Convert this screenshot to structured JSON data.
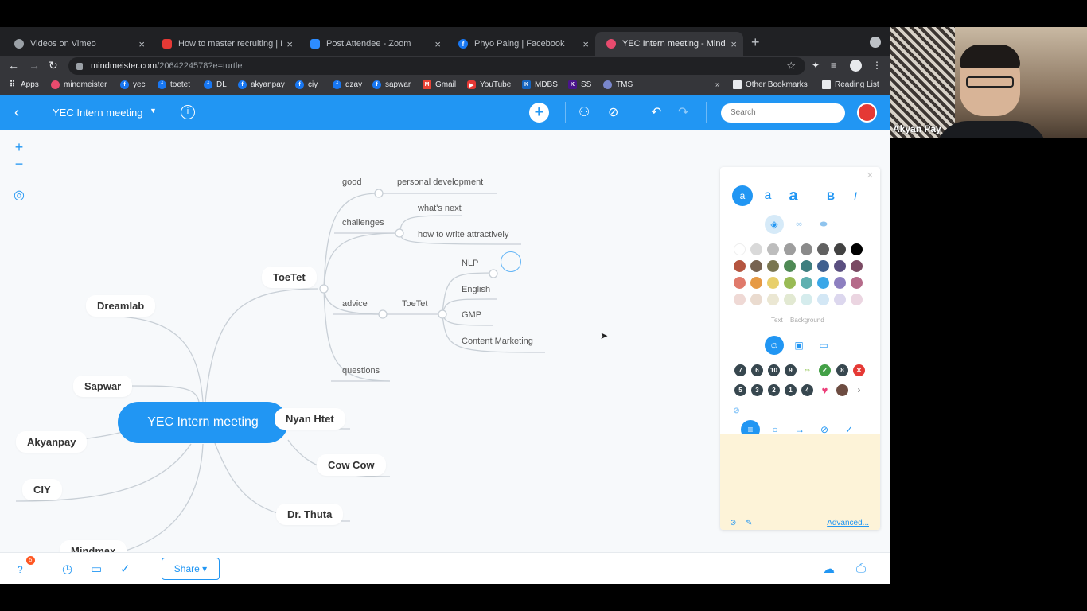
{
  "browser": {
    "tabs": [
      {
        "title": "Videos on Vimeo",
        "icon": "vimeo-icon"
      },
      {
        "title": "How to master recruiting | Mac",
        "icon": "youtube-icon"
      },
      {
        "title": "Post Attendee - Zoom",
        "icon": "zoom-icon"
      },
      {
        "title": "Phyo Paing | Facebook",
        "icon": "facebook-icon"
      },
      {
        "title": "YEC Intern meeting - MindMei",
        "icon": "mindmeister-icon"
      }
    ],
    "url_host": "mindmeister.com",
    "url_path": "/2064224578?e=turtle",
    "bookmarks": [
      "Apps",
      "mindmeister",
      "yec",
      "toetet",
      "DL",
      "akyanpay",
      "ciy",
      "dzay",
      "sapwar",
      "Gmail",
      "YouTube",
      "MDBS",
      "SS",
      "TMS"
    ],
    "bookmarks_more": "»",
    "other_bookmarks": "Other Bookmarks",
    "reading_list": "Reading List"
  },
  "app": {
    "map_title": "YEC Intern meeting",
    "search_placeholder": "Search",
    "accent": "#2196f3"
  },
  "map": {
    "root": "YEC Intern meeting",
    "left_nodes": [
      "Dreamlab",
      "Sapwar",
      "Akyanpay",
      "CIY",
      "Mindmax"
    ],
    "right_nodes": [
      "ToeTet",
      "Nyan Htet",
      "Cow Cow",
      "Dr. Thuta"
    ],
    "toetet_children": {
      "good": "good",
      "good_child": "personal development",
      "challenges": "challenges",
      "challenges_children": [
        "what's next",
        "how to write attractively"
      ],
      "advice": "advice",
      "advice_child": "ToeTet",
      "advice_grandchildren": [
        "NLP",
        "English",
        "GMP",
        "Content Marketing"
      ],
      "questions": "questions"
    }
  },
  "panel": {
    "font_sizes": [
      "a",
      "a",
      "a"
    ],
    "bold": "B",
    "italic": "I",
    "color_labels": [
      "Text",
      "Background"
    ],
    "icon_numbers_row1": [
      "7",
      "6",
      "10",
      "9"
    ],
    "icon_numbers_row2": [
      "5",
      "3",
      "2",
      "1",
      "4"
    ],
    "icon_8": "8",
    "advanced_link": "Advanced...",
    "swatch_rows": [
      [
        "#ffffff",
        "#d9d9d9",
        "#bdbdbd",
        "#9e9e9e",
        "#8a8a8a",
        "#616161",
        "#424242",
        "#000000"
      ],
      [
        "#b5553f",
        "#776350",
        "#7a7650",
        "#4f8a55",
        "#3f7f80",
        "#3f5f8f",
        "#5a4f80",
        "#7a4a63"
      ],
      [
        "#e07a6b",
        "#e69a45",
        "#e8cf6b",
        "#99bb55",
        "#5fb0b0",
        "#3aa7e8",
        "#8d7fc0",
        "#b56b8a"
      ],
      [
        "#efd9d5",
        "#eadbcf",
        "#ebe7d3",
        "#e2e9d2",
        "#d5eced",
        "#d3e7f5",
        "#dcd7ee",
        "#ebd5e1"
      ]
    ]
  },
  "bottom": {
    "notification_count": "5",
    "share_label": "Share ▾"
  },
  "webcam": {
    "participant_name": "Akyan Pay"
  }
}
